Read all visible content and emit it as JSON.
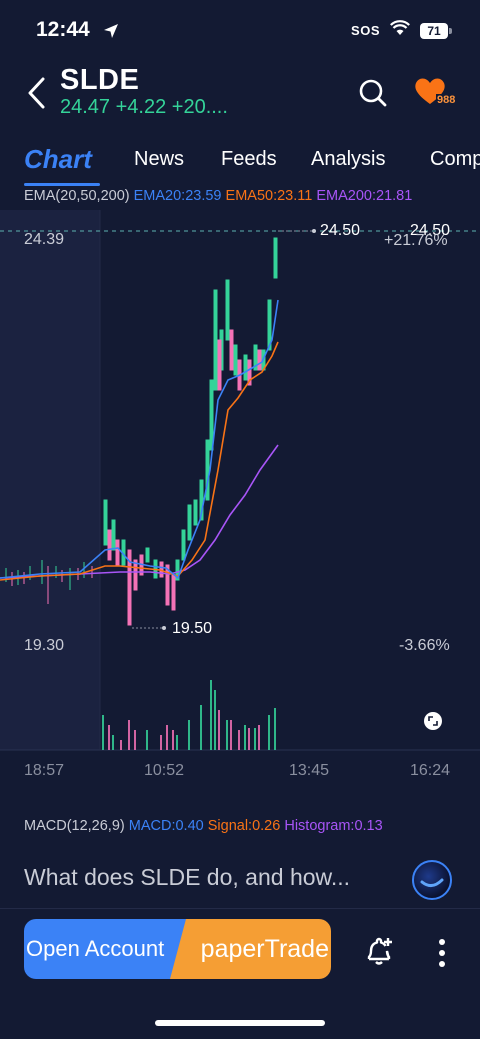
{
  "status_bar": {
    "time": "12:44",
    "sos": "SOS",
    "battery": "71"
  },
  "header": {
    "ticker": "SLDE",
    "quote": "24.47 +4.22 +20....",
    "watchers": "988"
  },
  "tabs": {
    "chart": "Chart",
    "items": [
      "News",
      "Feeds",
      "Analysis",
      "Comp"
    ]
  },
  "ema": {
    "label": "EMA(20,50,200)",
    "ema20": "EMA20:23.59",
    "ema50": "EMA50:23.11",
    "ema200": "EMA200:21.81"
  },
  "chart": {
    "price_high": "24.39",
    "price_low": "19.30",
    "high_marker": "24.50",
    "last_price": "24.50",
    "change_high": "+21.76%",
    "low_marker": "19.50",
    "change_low": "-3.66%",
    "time_labels": [
      "18:57",
      "10:52",
      "13:45",
      "16:24"
    ]
  },
  "macd": {
    "label": "MACD(12,26,9)",
    "macd": "MACD:0.40",
    "signal": "Signal:0.26",
    "histogram": "Histogram:0.13"
  },
  "assistant": {
    "question": "What does SLDE do, and how..."
  },
  "actions": {
    "open_account": "Open Account",
    "paper_trade": "paperTrade"
  },
  "colors": {
    "background": "#131a33",
    "up": "#34d399",
    "down": "#f472b6",
    "ema20": "#3b82f6",
    "ema50": "#f97316",
    "ema200": "#a855f7"
  }
}
